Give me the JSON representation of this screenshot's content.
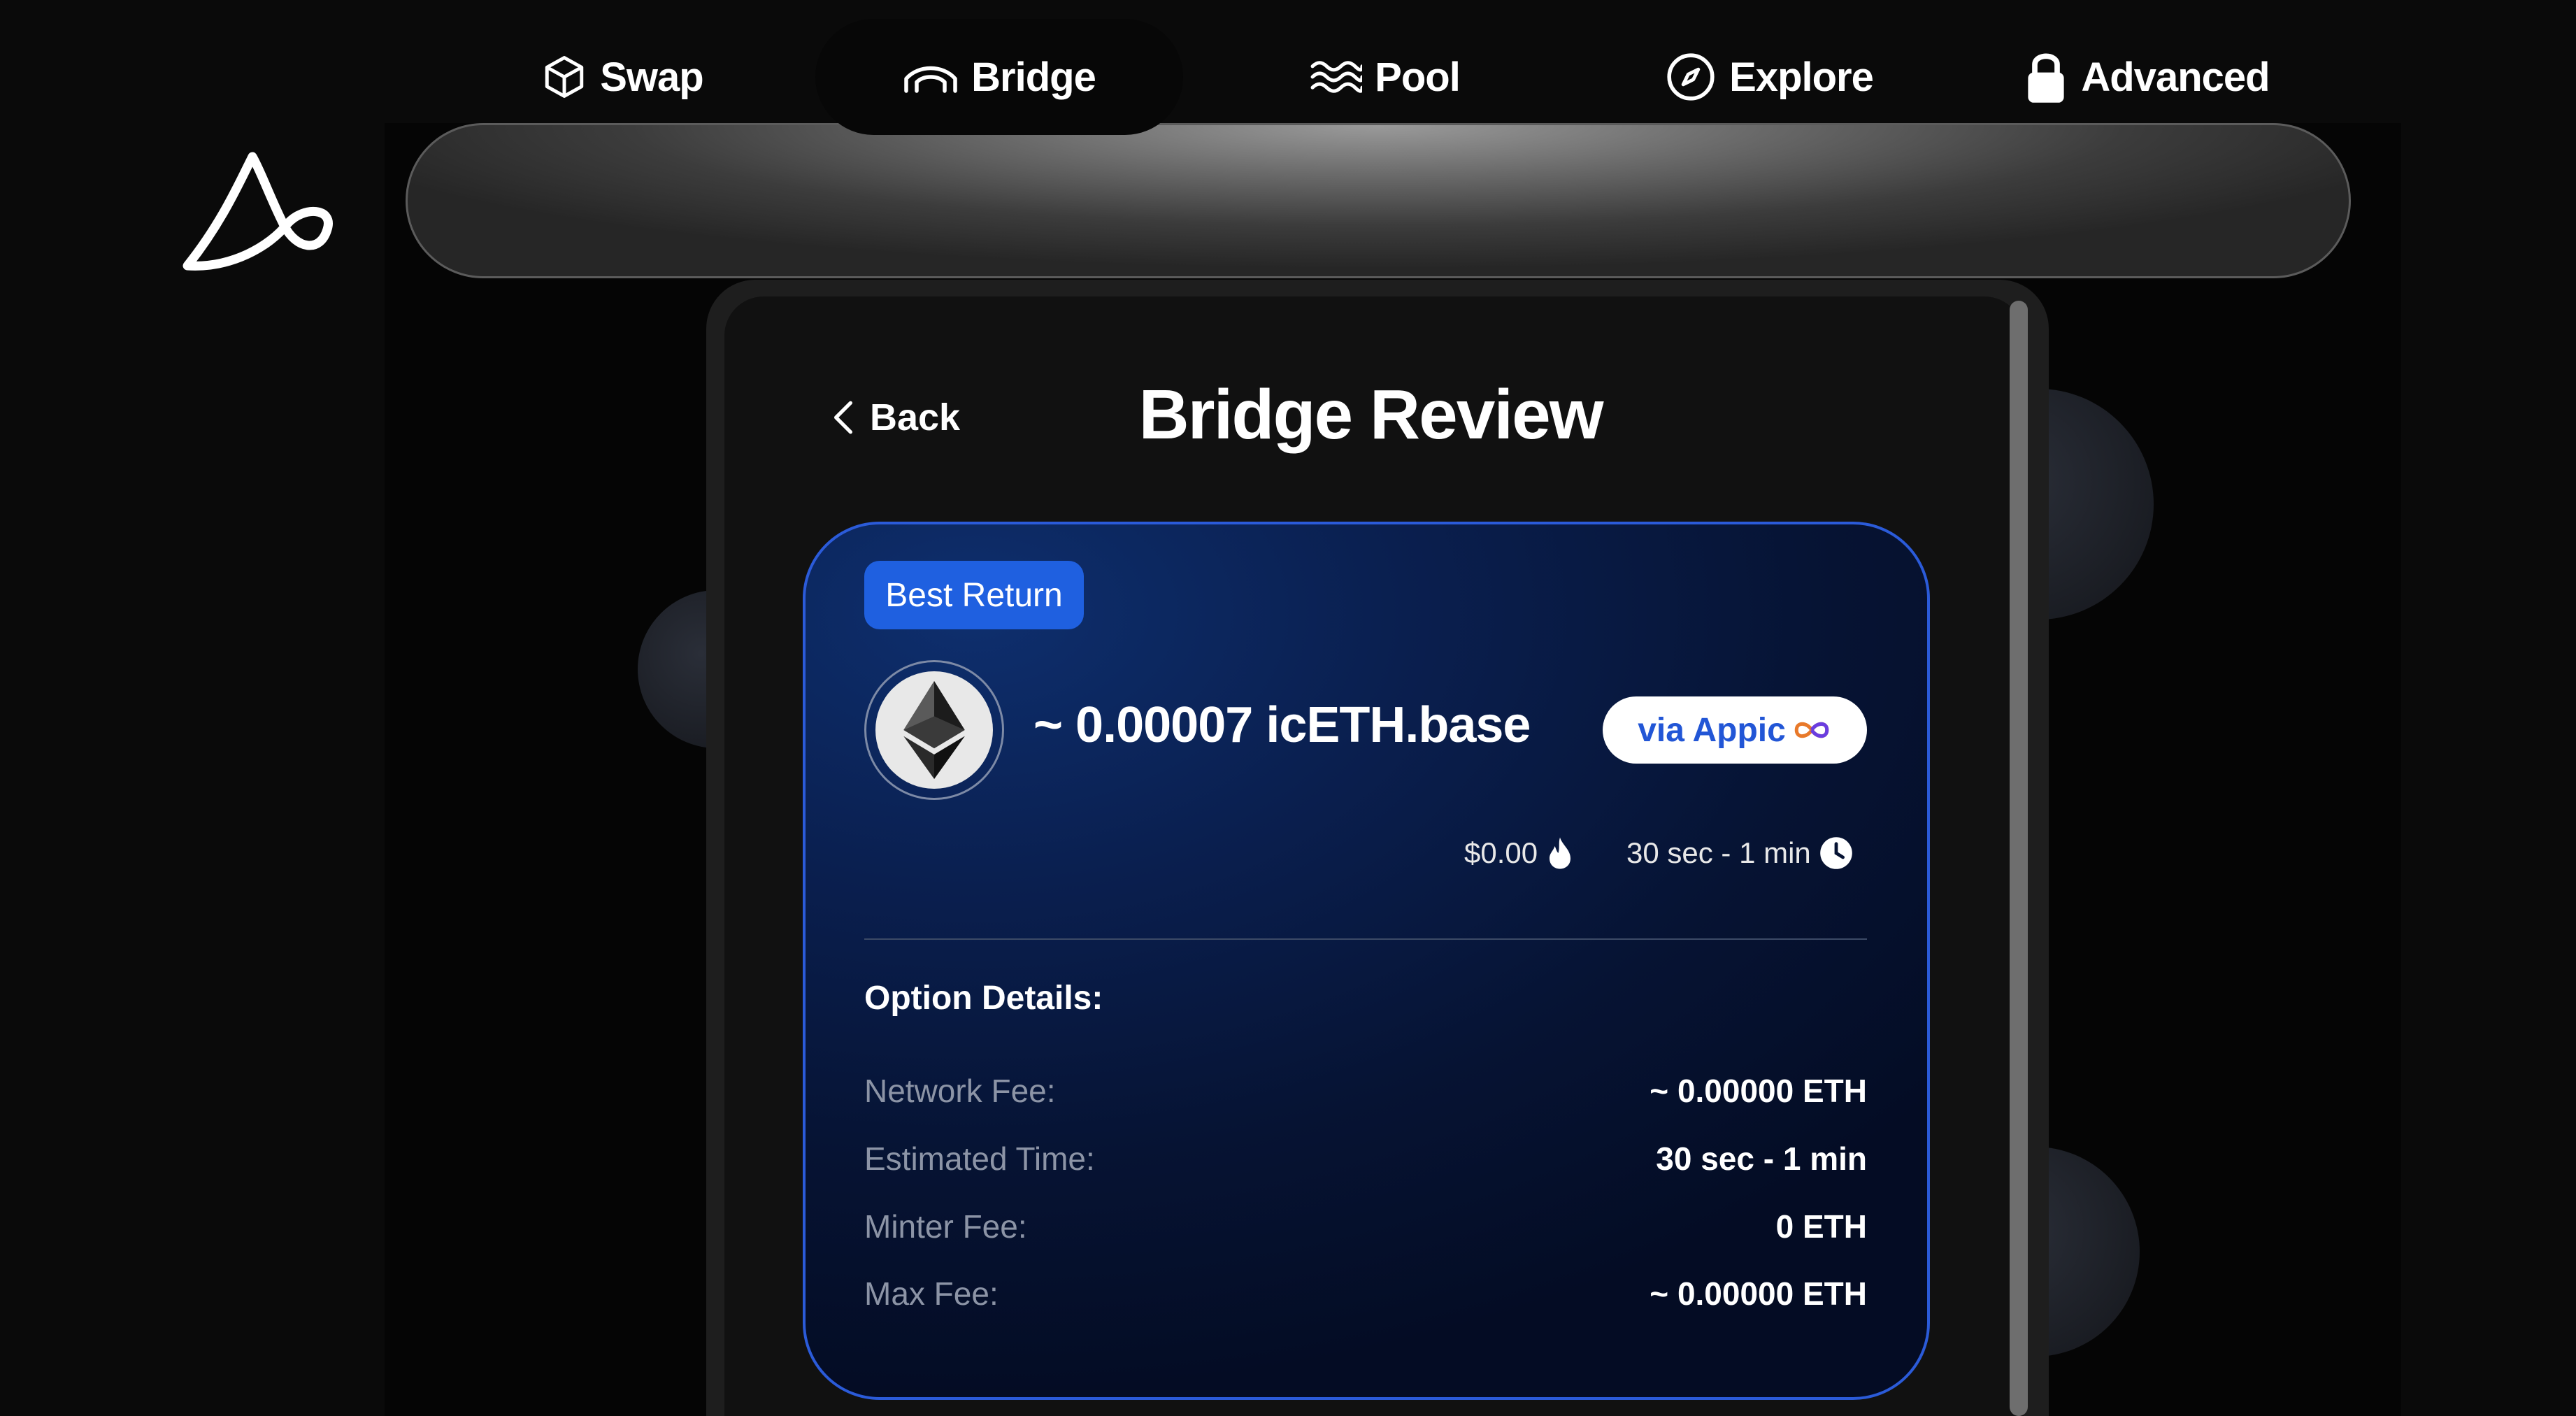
{
  "nav": {
    "items": [
      {
        "label": "Swap",
        "icon": "cube-icon"
      },
      {
        "label": "Bridge",
        "icon": "bridge-icon",
        "active": true
      },
      {
        "label": "Pool",
        "icon": "waves-icon"
      },
      {
        "label": "Explore",
        "icon": "compass-icon"
      },
      {
        "label": "Advanced",
        "icon": "lock-icon"
      }
    ]
  },
  "header": {
    "back_label": "Back",
    "title": "Bridge Review"
  },
  "option": {
    "badge": "Best Return",
    "amount": "~ 0.00007 icETH.base",
    "via": "via Appic",
    "fee_usd": "$0.00",
    "time": "30 sec - 1 min"
  },
  "details": {
    "label": "Option Details:",
    "rows": [
      {
        "key": "Network Fee:",
        "value": "~ 0.00000 ETH"
      },
      {
        "key": "Estimated Time:",
        "value": "30 sec - 1 min"
      },
      {
        "key": "Minter Fee:",
        "value": "0 ETH"
      },
      {
        "key": "Max Fee:",
        "value": "~ 0.00000 ETH"
      }
    ]
  },
  "colors": {
    "accent": "#1f60e0",
    "card_border": "#2b5bd9",
    "via_text": "#2256d6"
  }
}
